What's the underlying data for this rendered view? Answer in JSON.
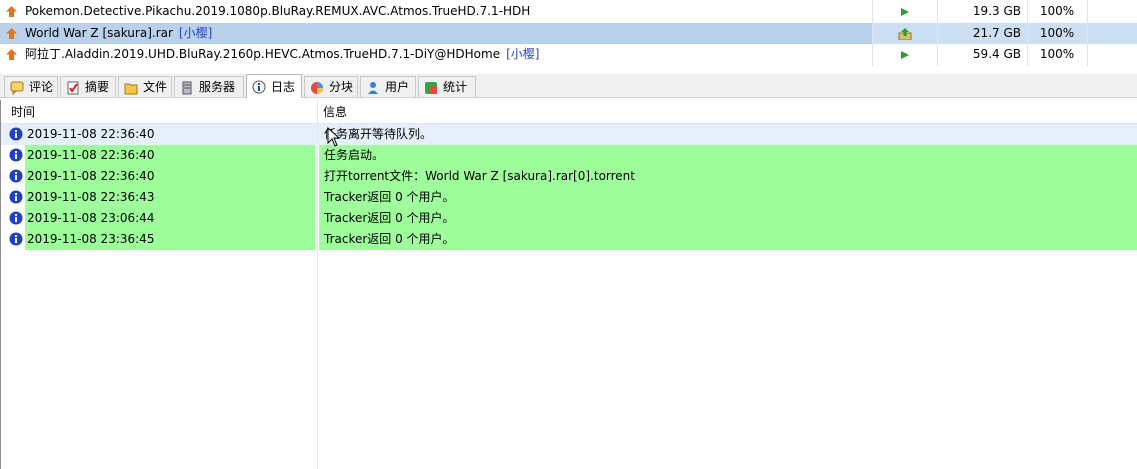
{
  "torrents": [
    {
      "name": "Pokemon.Detective.Pikachu.2019.1080p.BluRay.REMUX.AVC.Atmos.TrueHD.7.1-HDH",
      "tag": "",
      "size": "19.3 GB",
      "progress": "100%",
      "status": "play"
    },
    {
      "name": "World War Z [sakura].rar",
      "tag": "[小樱]",
      "size": "21.7 GB",
      "progress": "100%",
      "status": "seeding"
    },
    {
      "name": "阿拉丁.Aladdin.2019.UHD.BluRay.2160p.HEVC.Atmos.TrueHD.7.1-DiY@HDHome",
      "tag": "[小樱]",
      "size": "59.4 GB",
      "progress": "100%",
      "status": "play"
    }
  ],
  "tabs": [
    {
      "label": "评论",
      "icon": "comment-icon"
    },
    {
      "label": "摘要",
      "icon": "summary-icon"
    },
    {
      "label": "文件",
      "icon": "files-icon"
    },
    {
      "label": "服务器",
      "icon": "server-icon"
    },
    {
      "label": "日志",
      "icon": "log-icon",
      "active": true
    },
    {
      "label": "分块",
      "icon": "pieces-icon"
    },
    {
      "label": "用户",
      "icon": "users-icon"
    },
    {
      "label": "统计",
      "icon": "stats-icon"
    }
  ],
  "log": {
    "col_time": "时间",
    "col_message": "信息",
    "rows": [
      {
        "time": "2019-11-08 22:36:40",
        "message": "任务离开等待队列。"
      },
      {
        "time": "2019-11-08 22:36:40",
        "message": "任务启动。"
      },
      {
        "time": "2019-11-08 22:36:40",
        "message": "打开torrent文件：World War Z [sakura].rar[0].torrent"
      },
      {
        "time": "2019-11-08 22:36:43",
        "message": "Tracker返回 0 个用户。"
      },
      {
        "time": "2019-11-08 23:06:44",
        "message": "Tracker返回 0 个用户。"
      },
      {
        "time": "2019-11-08 23:36:45",
        "message": "Tracker返回 0 个用户。"
      }
    ]
  },
  "colors": {
    "log_highlight": "#9efe9b",
    "selected_row": "#cddff3",
    "tag_blue": "#2845c8",
    "info_blue": "#1f3fc4"
  }
}
